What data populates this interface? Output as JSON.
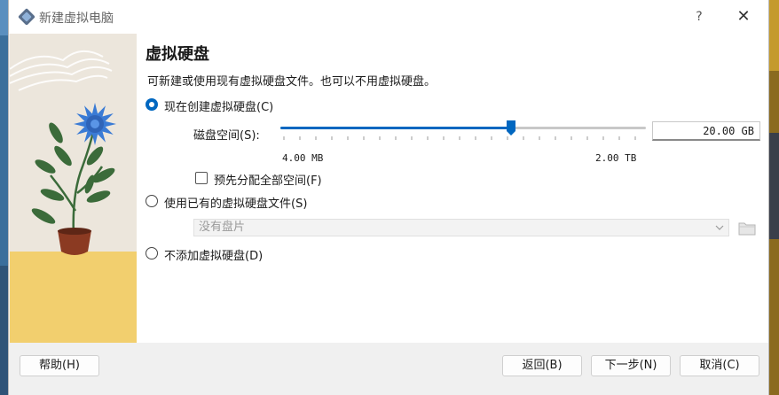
{
  "window": {
    "title": "新建虚拟电脑",
    "help_label": "?",
    "close_label": "✕",
    "app_icon": "virtualbox-icon"
  },
  "page": {
    "heading": "虚拟硬盘",
    "description": "可新建或使用现有虚拟硬盘文件。也可以不用虚拟硬盘。"
  },
  "options": {
    "create_new": {
      "label": "现在创建虚拟硬盘(C)",
      "selected": true
    },
    "use_existing": {
      "label": "使用已有的虚拟硬盘文件(S)",
      "selected": false
    },
    "no_disk": {
      "label": "不添加虚拟硬盘(D)",
      "selected": false
    }
  },
  "disk_size": {
    "label": "磁盘空间(S):",
    "value": "20.00 GB",
    "min_label": "4.00 MB",
    "max_label": "2.00 TB",
    "slider_fraction": 0.63
  },
  "preallocate": {
    "label": "预先分配全部空间(F)",
    "checked": false
  },
  "existing_file": {
    "selected_value": "没有盘片",
    "folder_icon": "folder-icon"
  },
  "buttons": {
    "help": "帮助(H)",
    "back": "返回(B)",
    "next": "下一步(N)",
    "cancel": "取消(C)"
  },
  "colors": {
    "accent": "#0067c0",
    "side_image_sky": "#ece6dc",
    "side_image_ground": "#f2cf6e",
    "flower": "#3a7bd5",
    "leaves": "#3b6b3a",
    "pot": "#8b3a22"
  }
}
